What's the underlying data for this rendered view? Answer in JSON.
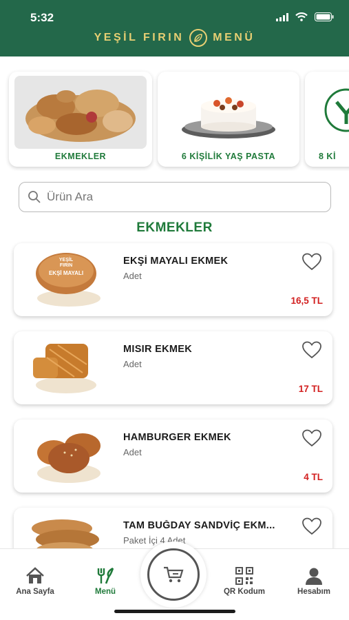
{
  "status_bar": {
    "time": "5:32"
  },
  "header": {
    "brand_left": "YEŞİL FIRIN",
    "brand_right": "MENÜ"
  },
  "categories": [
    {
      "label": "EKMEKLER"
    },
    {
      "label": "6 KİŞİLİK YAŞ PASTA"
    },
    {
      "label": "8 Kİ"
    }
  ],
  "search": {
    "placeholder": "Ürün Ara"
  },
  "section_title": "EKMEKLER",
  "products": [
    {
      "name": "EKŞİ MAYALI EKMEK",
      "unit": "Adet",
      "price": "16,5 TL"
    },
    {
      "name": "MISIR EKMEK",
      "unit": "Adet",
      "price": "17 TL"
    },
    {
      "name": "HAMBURGER EKMEK",
      "unit": "Adet",
      "price": "4 TL"
    },
    {
      "name": "TAM BUĞDAY SANDVİÇ EKM...",
      "unit": "Paket İçi 4 Adet",
      "price": ""
    }
  ],
  "bread_logo_text": {
    "line1": "YEŞİL",
    "line2": "FIRIN",
    "line3": "EKŞİ MAYALI"
  },
  "tabs": [
    {
      "label": "Ana Sayfa",
      "icon": "home-icon",
      "active": false
    },
    {
      "label": "Menü",
      "icon": "fork-knife-icon",
      "active": true
    },
    {
      "label": "QR Kodum",
      "icon": "qr-code-icon",
      "active": false
    },
    {
      "label": "Hesabım",
      "icon": "user-icon",
      "active": false
    }
  ],
  "colors": {
    "header": "#23684a",
    "brand": "#e7cf73",
    "accent_green": "#1f7a3a",
    "price_red": "#d21f1f"
  }
}
